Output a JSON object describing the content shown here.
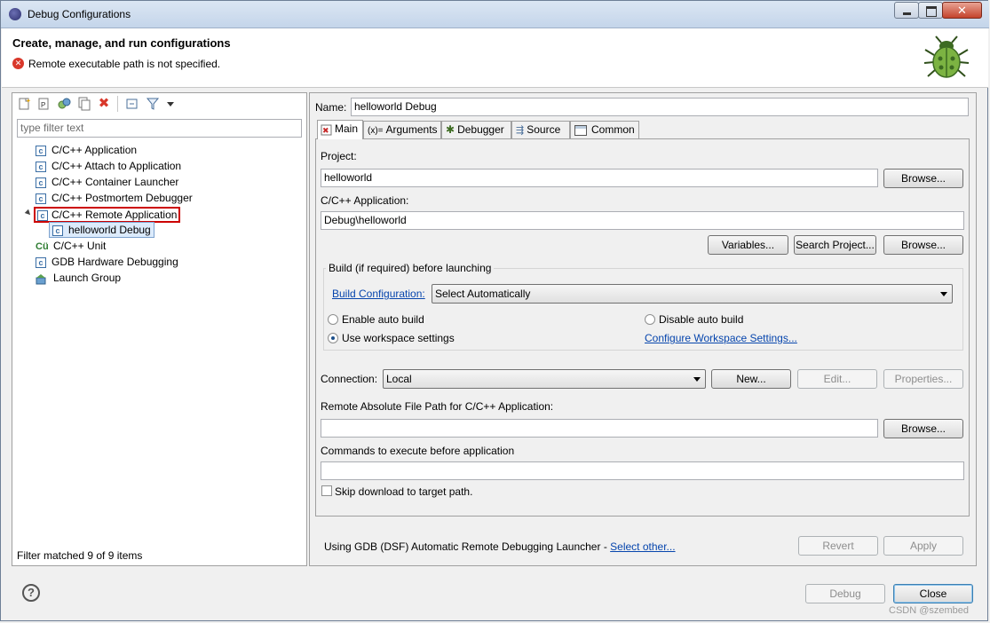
{
  "window": {
    "title": "Debug Configurations"
  },
  "header": {
    "heading": "Create, manage, and run configurations",
    "error": "Remote executable path is not specified."
  },
  "left": {
    "filter_placeholder": "type filter text",
    "tree": [
      {
        "label": "C/C++ Application"
      },
      {
        "label": "C/C++ Attach to Application"
      },
      {
        "label": "C/C++ Container Launcher"
      },
      {
        "label": "C/C++ Postmortem Debugger"
      },
      {
        "label": "C/C++ Remote Application"
      },
      {
        "label": "helloworld Debug"
      },
      {
        "label": "C/C++ Unit"
      },
      {
        "label": "GDB Hardware Debugging"
      },
      {
        "label": "Launch Group"
      }
    ],
    "status": "Filter matched 9 of 9 items"
  },
  "right": {
    "name_label": "Name:",
    "name_value": "helloworld Debug",
    "tabs": [
      {
        "label": "Main"
      },
      {
        "label": "Arguments"
      },
      {
        "label": "Debugger"
      },
      {
        "label": "Source"
      },
      {
        "label": "Common"
      }
    ],
    "project_label": "Project:",
    "project_value": "helloworld",
    "browse": "Browse...",
    "app_label": "C/C++ Application:",
    "app_value": "Debug\\helloworld",
    "variables": "Variables...",
    "search_project": "Search Project...",
    "build_group": "Build (if required) before launching",
    "build_config_link": "Build Configuration:",
    "build_config_value": "Select Automatically",
    "enable_auto": "Enable auto build",
    "disable_auto": "Disable auto build",
    "use_workspace": "Use workspace settings",
    "configure_link": "Configure Workspace Settings...",
    "connection_label": "Connection:",
    "connection_value": "Local",
    "new": "New...",
    "edit": "Edit...",
    "properties": "Properties...",
    "remote_path_label": "Remote Absolute File Path for C/C++ Application:",
    "remote_path_value": "",
    "commands_label": "Commands to execute before application",
    "commands_value": "",
    "skip_download": "Skip download to target path.",
    "launcher_text": "Using GDB (DSF) Automatic Remote Debugging Launcher - ",
    "select_other": "Select other...",
    "revert": "Revert",
    "apply": "Apply"
  },
  "footer": {
    "debug": "Debug",
    "close": "Close",
    "watermark": "CSDN @szembed"
  },
  "colors": {
    "link": "#0645ad",
    "error": "#d9382b",
    "selection_border": "#cc0000"
  }
}
